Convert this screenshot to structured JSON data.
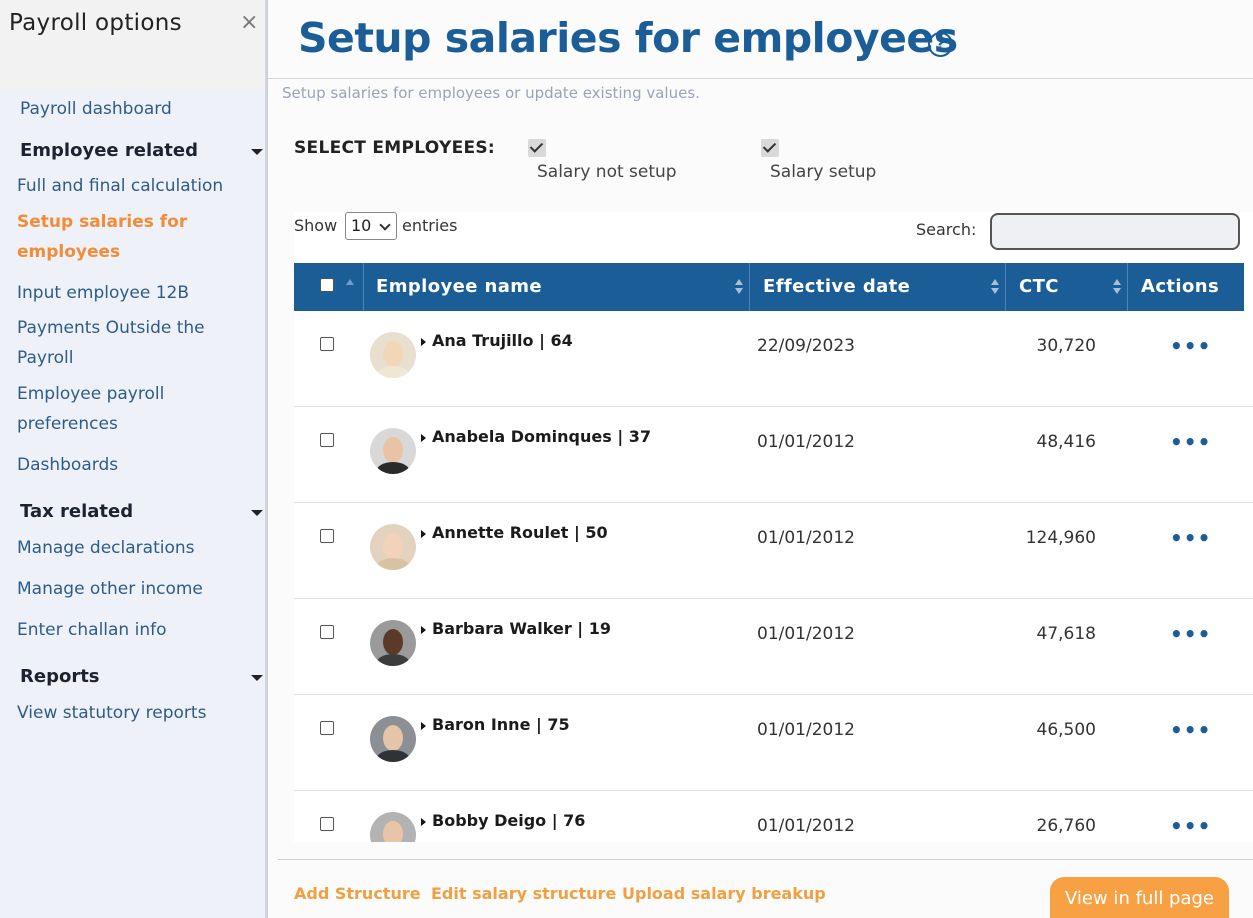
{
  "sidebar": {
    "title": "Payroll options",
    "close_glyph": "×",
    "dashboard": "Payroll dashboard",
    "sections": {
      "employee": {
        "label": "Employee related",
        "items": [
          "Full and final calculation",
          "Setup salaries for employees",
          "Input employee 12B",
          "Payments Outside the Payroll",
          "Employee payroll preferences",
          "Dashboards"
        ]
      },
      "tax": {
        "label": "Tax related",
        "items": [
          "Manage declarations",
          "Manage other income",
          "Enter challan info"
        ]
      },
      "reports": {
        "label": "Reports",
        "items": [
          "View statutory reports"
        ]
      }
    },
    "active_item": "Setup salaries for employees"
  },
  "main": {
    "title": "Setup salaries for employees",
    "help_glyph": "?",
    "subtitle": "Setup salaries for employees or update existing values.",
    "filters": {
      "label": "SELECT EMPLOYEES:",
      "options": [
        {
          "label": "Salary not setup",
          "checked": true
        },
        {
          "label": "Salary setup",
          "checked": true
        }
      ]
    },
    "table": {
      "show_label": "Show",
      "entries_value": "10",
      "entries_label": "entries",
      "search_label": "Search:",
      "search_value": "",
      "columns": [
        "Employee name",
        "Effective date",
        "CTC",
        "Actions"
      ],
      "rows": [
        {
          "name": "Ana Trujillo | 64",
          "date": "22/09/2023",
          "ctc": "30,720",
          "actions": "•••"
        },
        {
          "name": "Anabela Dominques | 37",
          "date": "01/01/2012",
          "ctc": "48,416",
          "actions": "•••"
        },
        {
          "name": "Annette Roulet | 50",
          "date": "01/01/2012",
          "ctc": "124,960",
          "actions": "•••"
        },
        {
          "name": "Barbara Walker | 19",
          "date": "01/01/2012",
          "ctc": "47,618",
          "actions": "•••"
        },
        {
          "name": "Baron Inne | 75",
          "date": "01/01/2012",
          "ctc": "46,500",
          "actions": "•••"
        },
        {
          "name": "Bobby Deigo | 76",
          "date": "01/01/2012",
          "ctc": "26,760",
          "actions": "•••"
        }
      ]
    },
    "footer": {
      "links": [
        "Add Structure",
        "Edit salary structure",
        "Upload salary breakup"
      ],
      "primary_button": "View in full page"
    }
  },
  "colors": {
    "accent_blue": "#1b5e97",
    "accent_orange": "#f28c38",
    "sidebar_bg": "#eef1f7"
  }
}
